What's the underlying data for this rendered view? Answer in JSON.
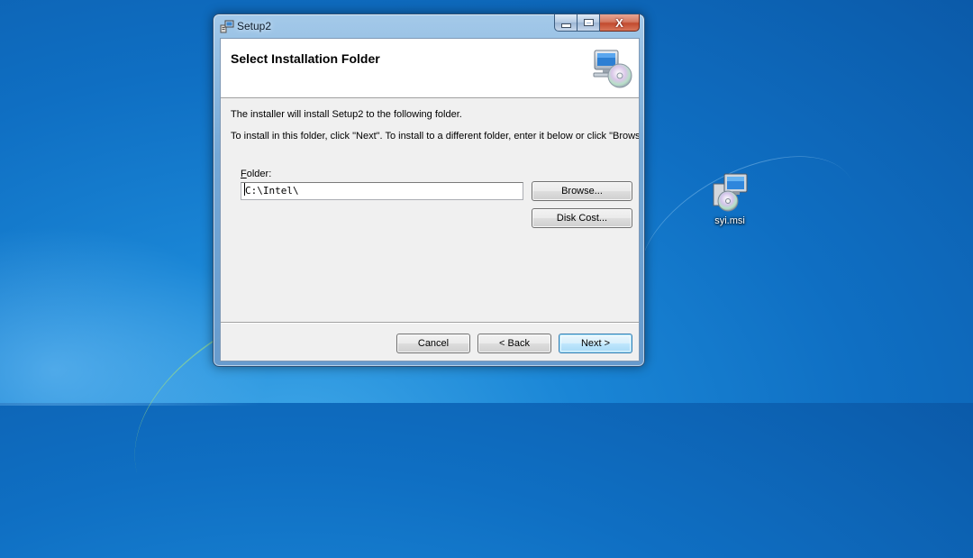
{
  "window": {
    "title": "Setup2",
    "caption_buttons": {
      "minimize": "_",
      "maximize": "□",
      "close": "X"
    }
  },
  "banner": {
    "title": "Select Installation Folder",
    "icon": "installer-computer-disc-icon"
  },
  "body": {
    "line1": "The installer will install Setup2 to the following folder.",
    "line2": "To install in this folder, click \"Next\". To install to a different folder, enter it below or click \"Browse\"."
  },
  "folder": {
    "label_mnemonic": "F",
    "label_rest": "older:",
    "value": "C:\\Intel\\"
  },
  "buttons": {
    "browse": "Browse...",
    "disk_cost": "Disk Cost...",
    "cancel": "Cancel",
    "back": "< Back",
    "next": "Next >"
  },
  "desktop": {
    "icons": [
      {
        "label": "syi.msi",
        "icon": "msi-installer-icon"
      }
    ]
  },
  "colors": {
    "desktop": "#0f6fc3",
    "window_frame": "#78aad7",
    "client_bg": "#f0f0f0",
    "default_button_border": "#3c7fb1"
  }
}
